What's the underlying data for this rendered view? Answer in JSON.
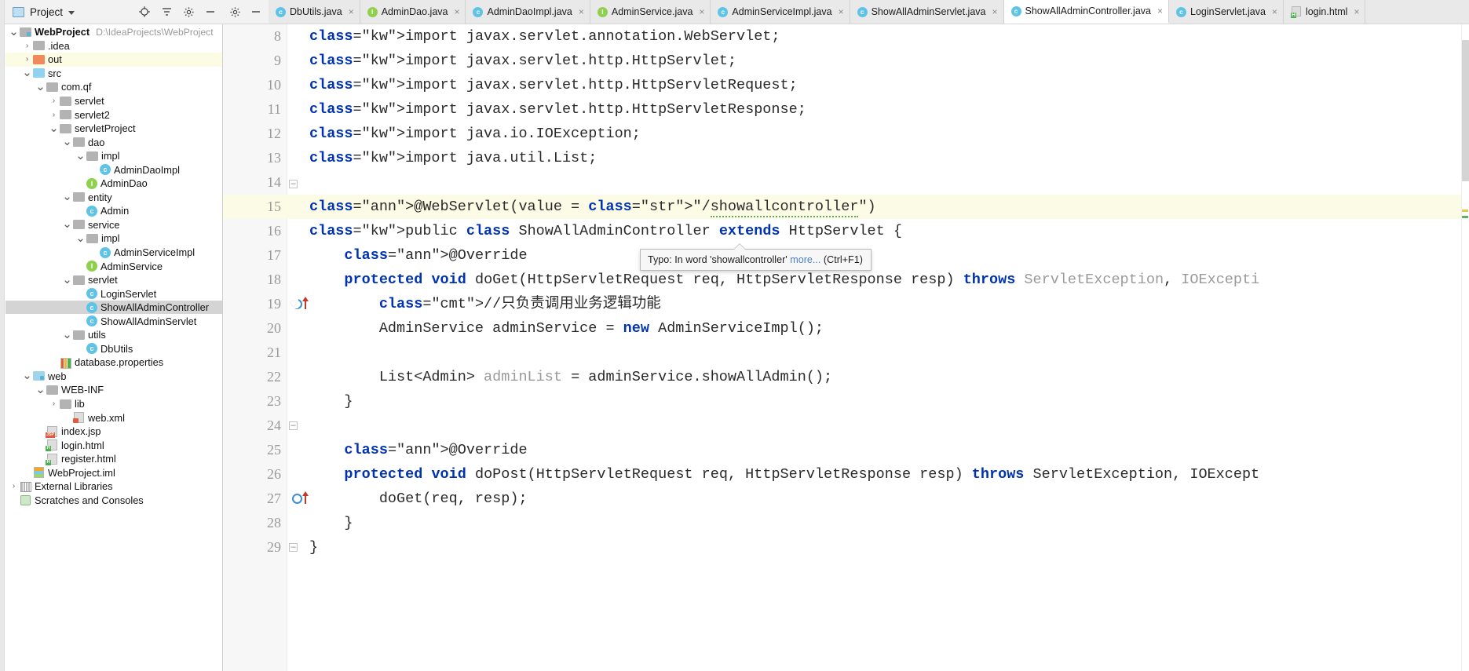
{
  "project_panel": {
    "title": "Project",
    "icons": [
      "project-view-icon",
      "locate-icon",
      "collapse-all-icon",
      "settings-icon",
      "minimize-icon"
    ]
  },
  "tree": [
    {
      "indent": 0,
      "arrow": "down",
      "icon": "module-folder",
      "label": "WebProject",
      "bold": true,
      "path": "D:\\IdeaProjects\\WebProject",
      "state": "normal"
    },
    {
      "indent": 1,
      "arrow": "right",
      "icon": "folder-gray",
      "label": ".idea",
      "state": "normal"
    },
    {
      "indent": 1,
      "arrow": "right",
      "icon": "folder-orange",
      "label": "out",
      "state": "highlight"
    },
    {
      "indent": 1,
      "arrow": "down",
      "icon": "folder-blue",
      "label": "src",
      "state": "normal"
    },
    {
      "indent": 2,
      "arrow": "down",
      "icon": "package",
      "label": "com.qf",
      "state": "normal"
    },
    {
      "indent": 3,
      "arrow": "right",
      "icon": "package",
      "label": "servlet",
      "state": "normal"
    },
    {
      "indent": 3,
      "arrow": "right",
      "icon": "package",
      "label": "servlet2",
      "state": "normal"
    },
    {
      "indent": 3,
      "arrow": "down",
      "icon": "package",
      "label": "servletProject",
      "state": "normal"
    },
    {
      "indent": 4,
      "arrow": "down",
      "icon": "package",
      "label": "dao",
      "state": "normal"
    },
    {
      "indent": 5,
      "arrow": "down",
      "icon": "package",
      "label": "impl",
      "state": "normal"
    },
    {
      "indent": 6,
      "arrow": "none",
      "icon": "class",
      "label": "AdminDaoImpl",
      "state": "normal"
    },
    {
      "indent": 5,
      "arrow": "none",
      "icon": "interface",
      "label": "AdminDao",
      "state": "normal"
    },
    {
      "indent": 4,
      "arrow": "down",
      "icon": "package",
      "label": "entity",
      "state": "normal"
    },
    {
      "indent": 5,
      "arrow": "none",
      "icon": "class",
      "label": "Admin",
      "state": "normal"
    },
    {
      "indent": 4,
      "arrow": "down",
      "icon": "package",
      "label": "service",
      "state": "normal"
    },
    {
      "indent": 5,
      "arrow": "down",
      "icon": "package",
      "label": "impl",
      "state": "normal"
    },
    {
      "indent": 6,
      "arrow": "none",
      "icon": "class",
      "label": "AdminServiceImpl",
      "state": "normal"
    },
    {
      "indent": 5,
      "arrow": "none",
      "icon": "interface",
      "label": "AdminService",
      "state": "normal"
    },
    {
      "indent": 4,
      "arrow": "down",
      "icon": "package",
      "label": "servlet",
      "state": "normal"
    },
    {
      "indent": 5,
      "arrow": "none",
      "icon": "class",
      "label": "LoginServlet",
      "state": "normal"
    },
    {
      "indent": 5,
      "arrow": "none",
      "icon": "class",
      "label": "ShowAllAdminController",
      "state": "selected"
    },
    {
      "indent": 5,
      "arrow": "none",
      "icon": "class",
      "label": "ShowAllAdminServlet",
      "state": "normal"
    },
    {
      "indent": 4,
      "arrow": "down",
      "icon": "package",
      "label": "utils",
      "state": "normal"
    },
    {
      "indent": 5,
      "arrow": "none",
      "icon": "class",
      "label": "DbUtils",
      "state": "normal"
    },
    {
      "indent": 3,
      "arrow": "none",
      "icon": "properties",
      "label": "database.properties",
      "state": "normal"
    },
    {
      "indent": 1,
      "arrow": "down",
      "icon": "folder-web",
      "label": "web",
      "state": "normal"
    },
    {
      "indent": 2,
      "arrow": "down",
      "icon": "folder-gray",
      "label": "WEB-INF",
      "state": "normal"
    },
    {
      "indent": 3,
      "arrow": "right",
      "icon": "folder-gray",
      "label": "lib",
      "state": "normal"
    },
    {
      "indent": 4,
      "arrow": "none",
      "icon": "xml",
      "label": "web.xml",
      "state": "normal"
    },
    {
      "indent": 2,
      "arrow": "none",
      "icon": "jsp",
      "label": "index.jsp",
      "state": "normal"
    },
    {
      "indent": 2,
      "arrow": "none",
      "icon": "html",
      "label": "login.html",
      "state": "normal"
    },
    {
      "indent": 2,
      "arrow": "none",
      "icon": "html",
      "label": "register.html",
      "state": "normal"
    },
    {
      "indent": 1,
      "arrow": "none",
      "icon": "iml",
      "label": "WebProject.iml",
      "state": "normal"
    },
    {
      "indent": 0,
      "arrow": "right",
      "icon": "external-libraries",
      "label": "External Libraries",
      "state": "normal"
    },
    {
      "indent": 0,
      "arrow": "none",
      "icon": "scratches",
      "label": "Scratches and Consoles",
      "state": "normal"
    }
  ],
  "tabs": [
    {
      "label": "DbUtils.java",
      "kind": "class",
      "active": false,
      "closable": true
    },
    {
      "label": "AdminDao.java",
      "kind": "interface",
      "active": false,
      "closable": true
    },
    {
      "label": "AdminDaoImpl.java",
      "kind": "class",
      "active": false,
      "closable": true
    },
    {
      "label": "AdminService.java",
      "kind": "interface",
      "active": false,
      "closable": true
    },
    {
      "label": "AdminServiceImpl.java",
      "kind": "class",
      "active": false,
      "closable": true
    },
    {
      "label": "ShowAllAdminServlet.java",
      "kind": "class",
      "active": false,
      "closable": true
    },
    {
      "label": "ShowAllAdminController.java",
      "kind": "class",
      "active": true,
      "closable": true
    },
    {
      "label": "LoginServlet.java",
      "kind": "class",
      "active": false,
      "closable": true
    },
    {
      "label": "login.html",
      "kind": "html",
      "active": false,
      "closable": true
    }
  ],
  "editor": {
    "first_line": 8,
    "highlighted_line": 15,
    "lines": [
      {
        "n": 8,
        "text": "import javax.servlet.annotation.WebServlet;"
      },
      {
        "n": 9,
        "text": "import javax.servlet.http.HttpServlet;"
      },
      {
        "n": 10,
        "text": "import javax.servlet.http.HttpServletRequest;"
      },
      {
        "n": 11,
        "text": "import javax.servlet.http.HttpServletResponse;"
      },
      {
        "n": 12,
        "text": "import java.io.IOException;"
      },
      {
        "n": 13,
        "text": "import java.util.List;"
      },
      {
        "n": 14,
        "text": ""
      },
      {
        "n": 15,
        "text": "@WebServlet(value = \"/showallcontroller\")"
      },
      {
        "n": 16,
        "text": "public class ShowAllAdminController extends HttpServlet {"
      },
      {
        "n": 17,
        "text": "    @Override"
      },
      {
        "n": 18,
        "text": "    protected void doGet(HttpServletRequest req, HttpServletResponse resp) throws ServletException, IOExcepti"
      },
      {
        "n": 19,
        "text": "        //只负责调用业务逻辑功能"
      },
      {
        "n": 20,
        "text": "        AdminService adminService = new AdminServiceImpl();"
      },
      {
        "n": 21,
        "text": ""
      },
      {
        "n": 22,
        "text": "        List<Admin> adminList = adminService.showAllAdmin();"
      },
      {
        "n": 23,
        "text": "    }"
      },
      {
        "n": 24,
        "text": ""
      },
      {
        "n": 25,
        "text": "    @Override"
      },
      {
        "n": 26,
        "text": "    protected void doPost(HttpServletRequest req, HttpServletResponse resp) throws ServletException, IOExcept"
      },
      {
        "n": 27,
        "text": "        doGet(req, resp);"
      },
      {
        "n": 28,
        "text": "    }"
      },
      {
        "n": 29,
        "text": "}"
      }
    ]
  },
  "tooltip": {
    "message": "Typo: In word 'showallcontroller'",
    "more_link": "more...",
    "shortcut": "(Ctrl+F1)"
  },
  "colors": {
    "keyword": "#0033b3",
    "string": "#067d17",
    "annotation": "#9e880d",
    "comment": "#8c8c8c",
    "selection": "#d4d4d4",
    "line_highlight": "#fcfbe6",
    "tab_active_bg": "#ffffff",
    "class_badge": "#5fc3e8",
    "interface_badge": "#8fd14f"
  }
}
